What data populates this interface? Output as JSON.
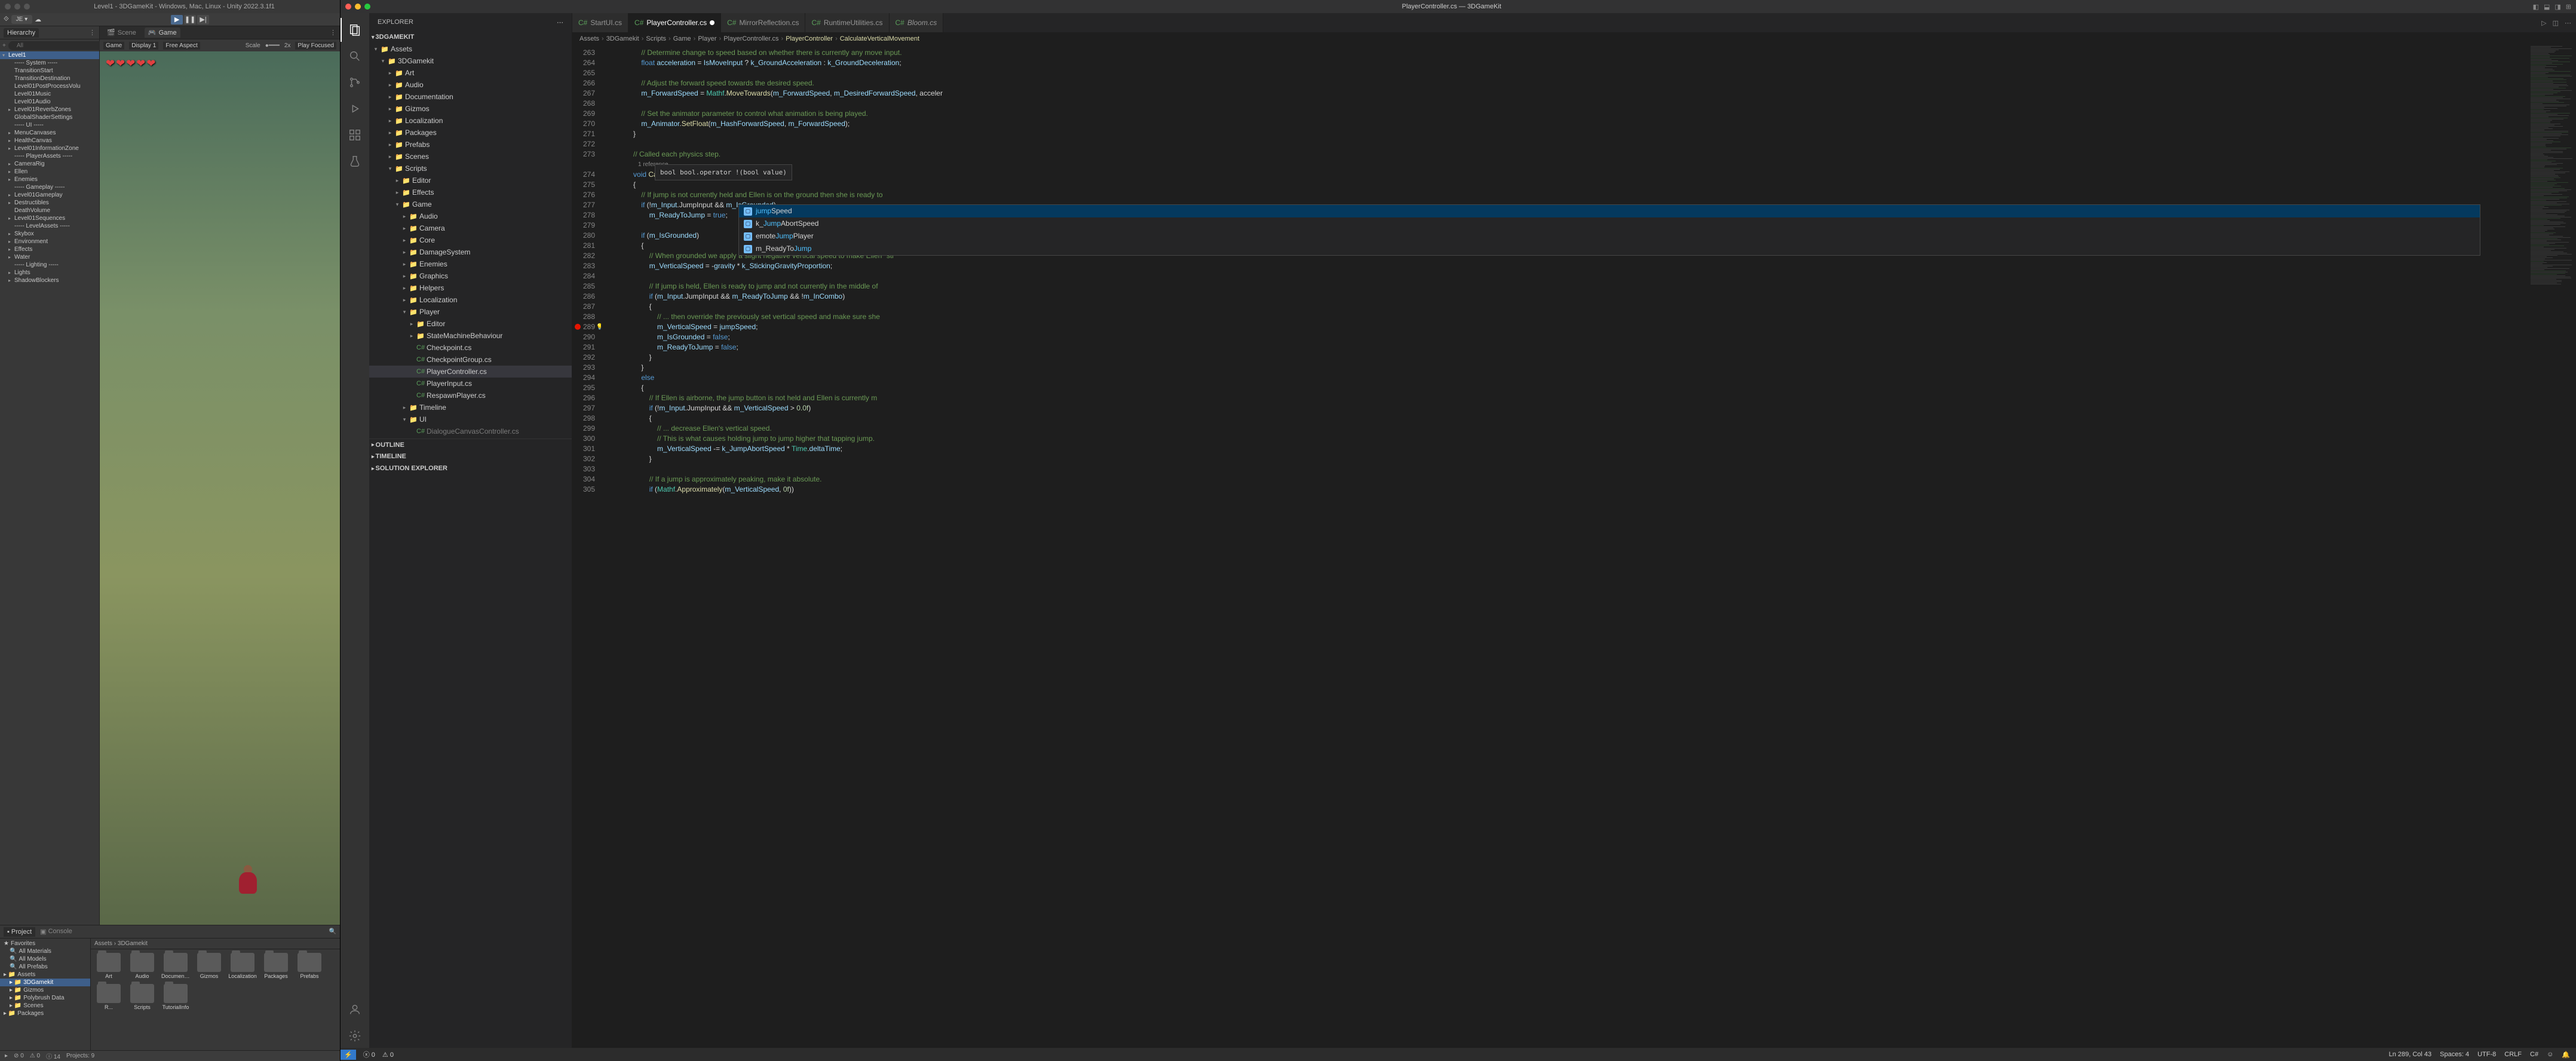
{
  "unity": {
    "title": "Level1 - 3DGameKit - Windows, Mac, Linux - Unity 2022.3.1f1",
    "account": "JE ▾",
    "hierarchy": {
      "tab": "Hierarchy",
      "search_ph": "All",
      "nodes": [
        {
          "l": "Level1",
          "d": 0,
          "sel": true,
          "exp": true
        },
        {
          "l": "----- System -----",
          "d": 1
        },
        {
          "l": "TransitionStart",
          "d": 1
        },
        {
          "l": "TransitionDestination",
          "d": 1
        },
        {
          "l": "Level01PostProcessVolu",
          "d": 1
        },
        {
          "l": "Level01Music",
          "d": 1
        },
        {
          "l": "Level01Audio",
          "d": 1
        },
        {
          "l": "Level01ReverbZones",
          "d": 1,
          "exp": false
        },
        {
          "l": "GlobalShaderSettings",
          "d": 1
        },
        {
          "l": "----- UI -----",
          "d": 1
        },
        {
          "l": "MenuCanvases",
          "d": 1,
          "exp": false
        },
        {
          "l": "HealthCanvas",
          "d": 1,
          "exp": false
        },
        {
          "l": "Level01InformationZone",
          "d": 1,
          "exp": false
        },
        {
          "l": "----- PlayerAssets -----",
          "d": 1
        },
        {
          "l": "CameraRig",
          "d": 1,
          "exp": false
        },
        {
          "l": "Ellen",
          "d": 1,
          "exp": false
        },
        {
          "l": "Enemies",
          "d": 1,
          "exp": false
        },
        {
          "l": "----- Gameplay -----",
          "d": 1
        },
        {
          "l": "Level01Gameplay",
          "d": 1,
          "exp": false
        },
        {
          "l": "Destructibles",
          "d": 1,
          "exp": false
        },
        {
          "l": "DeathVolume",
          "d": 1
        },
        {
          "l": "Level01Sequences",
          "d": 1,
          "exp": false
        },
        {
          "l": "----- LevelAssets -----",
          "d": 1
        },
        {
          "l": "Skybox",
          "d": 1,
          "exp": false
        },
        {
          "l": "Environment",
          "d": 1,
          "exp": false
        },
        {
          "l": "Effects",
          "d": 1,
          "exp": false
        },
        {
          "l": "Water",
          "d": 1,
          "exp": false
        },
        {
          "l": "----- Lighting -----",
          "d": 1
        },
        {
          "l": "Lights",
          "d": 1,
          "exp": false
        },
        {
          "l": "ShadowBlockers",
          "d": 1,
          "exp": false
        }
      ]
    },
    "game": {
      "tabs": [
        "Scene",
        "Game"
      ],
      "active_tab": 1,
      "dropdown1": "Game",
      "dropdown2": "Display 1",
      "dropdown3": "Free Aspect",
      "scale_label": "Scale",
      "scale_value": "2x",
      "play_focused": "Play Focused"
    },
    "project": {
      "tabs": [
        "Project",
        "Console"
      ],
      "active": 0,
      "tree": [
        {
          "l": "Favorites",
          "d": 0,
          "star": true
        },
        {
          "l": "All Materials",
          "d": 1,
          "q": true
        },
        {
          "l": "All Models",
          "d": 1,
          "q": true
        },
        {
          "l": "All Prefabs",
          "d": 1,
          "q": true
        },
        {
          "l": "Assets",
          "d": 0
        },
        {
          "l": "3DGamekit",
          "d": 1,
          "sel": true
        },
        {
          "l": "Gizmos",
          "d": 1
        },
        {
          "l": "Polybrush Data",
          "d": 1
        },
        {
          "l": "Scenes",
          "d": 1
        },
        {
          "l": "Packages",
          "d": 0
        }
      ],
      "breadcrumb": "Assets  ›  3DGamekit",
      "folders_row1": [
        "Art",
        "Audio",
        "Document...",
        "Gizmos",
        "Localization",
        "Packages",
        "Prefabs",
        "R..."
      ],
      "folders_row2": [
        "Scripts",
        "TutorialInfo"
      ]
    },
    "status": {
      "errors": "0",
      "warnings": "0",
      "info": "14",
      "projects": "Projects: 9"
    }
  },
  "vscode": {
    "title": "PlayerController.cs — 3DGameKit",
    "explorer": {
      "header": "EXPLORER",
      "root": "3DGAMEKIT",
      "tree": [
        {
          "l": "Assets",
          "d": 0,
          "f": true,
          "exp": true
        },
        {
          "l": "3DGamekit",
          "d": 1,
          "f": true,
          "exp": true
        },
        {
          "l": "Art",
          "d": 2,
          "f": true
        },
        {
          "l": "Audio",
          "d": 2,
          "f": true
        },
        {
          "l": "Documentation",
          "d": 2,
          "f": true
        },
        {
          "l": "Gizmos",
          "d": 2,
          "f": true
        },
        {
          "l": "Localization",
          "d": 2,
          "f": true
        },
        {
          "l": "Packages",
          "d": 2,
          "f": true
        },
        {
          "l": "Prefabs",
          "d": 2,
          "f": true
        },
        {
          "l": "Scenes",
          "d": 2,
          "f": true
        },
        {
          "l": "Scripts",
          "d": 2,
          "f": true,
          "exp": true
        },
        {
          "l": "Editor",
          "d": 3,
          "f": true
        },
        {
          "l": "Effects",
          "d": 3,
          "f": true
        },
        {
          "l": "Game",
          "d": 3,
          "f": true,
          "exp": true
        },
        {
          "l": "Audio",
          "d": 4,
          "f": true
        },
        {
          "l": "Camera",
          "d": 4,
          "f": true
        },
        {
          "l": "Core",
          "d": 4,
          "f": true
        },
        {
          "l": "DamageSystem",
          "d": 4,
          "f": true
        },
        {
          "l": "Enemies",
          "d": 4,
          "f": true
        },
        {
          "l": "Graphics",
          "d": 4,
          "f": true
        },
        {
          "l": "Helpers",
          "d": 4,
          "f": true
        },
        {
          "l": "Localization",
          "d": 4,
          "f": true
        },
        {
          "l": "Player",
          "d": 4,
          "f": true,
          "exp": true
        },
        {
          "l": "Editor",
          "d": 5,
          "f": true
        },
        {
          "l": "StateMachineBehaviour",
          "d": 5,
          "f": true
        },
        {
          "l": "Checkpoint.cs",
          "d": 5
        },
        {
          "l": "CheckpointGroup.cs",
          "d": 5
        },
        {
          "l": "PlayerController.cs",
          "d": 5,
          "sel": true
        },
        {
          "l": "PlayerInput.cs",
          "d": 5
        },
        {
          "l": "RespawnPlayer.cs",
          "d": 5
        },
        {
          "l": "Timeline",
          "d": 4,
          "f": true
        },
        {
          "l": "UI",
          "d": 4,
          "f": true,
          "exp": true
        },
        {
          "l": "DialogueCanvasController.cs",
          "d": 5,
          "dim": true
        }
      ],
      "outline": "OUTLINE",
      "timeline": "TIMELINE",
      "solution": "SOLUTION EXPLORER"
    },
    "tabs": [
      {
        "l": "StartUI.cs"
      },
      {
        "l": "PlayerController.cs",
        "active": true,
        "dirty": true
      },
      {
        "l": "MirrorReflection.cs"
      },
      {
        "l": "RuntimeUtilities.cs"
      },
      {
        "l": "Bloom.cs",
        "italic": true
      }
    ],
    "breadcrumb": [
      "Assets",
      "3DGamekit",
      "Scripts",
      "Game",
      "Player",
      "PlayerController.cs",
      "PlayerController",
      "CalculateVerticalMovement"
    ],
    "code": {
      "start": 263,
      "lines": [
        "                // Determine change to speed based on whether there is currently any move input.",
        "                float acceleration = IsMoveInput ? k_GroundAcceleration : k_GroundDeceleration;",
        "",
        "                // Adjust the forward speed towards the desired speed.",
        "                m_ForwardSpeed = Mathf.MoveTowards(m_ForwardSpeed, m_DesiredForwardSpeed, acceler",
        "",
        "                // Set the animator parameter to control what animation is being played.",
        "                m_Animator.SetFloat(m_HashForwardSpeed, m_ForwardSpeed);",
        "            }",
        "",
        "            // Called each physics step.",
        "            void CalculateVerticalMovement()",
        "            {",
        "                // If jump is not currently held and Ellen is on the ground then she is ready to ",
        "                if (!m_Input.JumpInput && m_IsGrounded)",
        "                    m_ReadyToJump = true;",
        "",
        "                if (m_IsGrounded)",
        "                {",
        "                    // When grounded we apply a slight negative vertical speed to make Ellen \"sti",
        "                    m_VerticalSpeed = -gravity * k_StickingGravityProportion;",
        "",
        "                    // If jump is held, Ellen is ready to jump and not currently in the middle of ",
        "                    if (m_Input.JumpInput && m_ReadyToJump && !m_InCombo)",
        "                    {",
        "                        // ... then override the previously set vertical speed and make sure she ",
        "                        m_VerticalSpeed = jumpSpeed;",
        "                        m_IsGrounded = false;",
        "                        m_ReadyToJump = false;",
        "                    }",
        "                }",
        "                else",
        "                {",
        "                    // If Ellen is airborne, the jump button is not held and Ellen is currently m",
        "                    if (!m_Input.JumpInput && m_VerticalSpeed > 0.0f)",
        "                    {",
        "                        // ... decrease Ellen's vertical speed.",
        "                        // This is what causes holding jump to jump higher that tapping jump.",
        "                        m_VerticalSpeed -= k_JumpAbortSpeed * Time.deltaTime;",
        "                    }",
        "",
        "                    // If a jump is approximately peaking, make it absolute.",
        "                    if (Mathf.Approximately(m_VerticalSpeed, 0f))"
      ],
      "ref_text": "1 reference",
      "breakpoint_line": 289,
      "tooltip": "bool bool.operator !(bool value)",
      "suggestions": [
        {
          "l": "jumpSpeed",
          "hl": "jump",
          "sel": true
        },
        {
          "l": "k_JumpAbortSpeed",
          "hl": "Jump"
        },
        {
          "l": "emoteJumpPlayer",
          "hl": "Jump"
        },
        {
          "l": "m_ReadyToJump",
          "hl": "Jump"
        }
      ]
    },
    "status": {
      "errors": "0",
      "warnings": "0",
      "pos": "Ln 289, Col 43",
      "spaces": "Spaces: 4",
      "enc": "UTF-8",
      "eol": "CRLF",
      "lang": "C#"
    }
  }
}
